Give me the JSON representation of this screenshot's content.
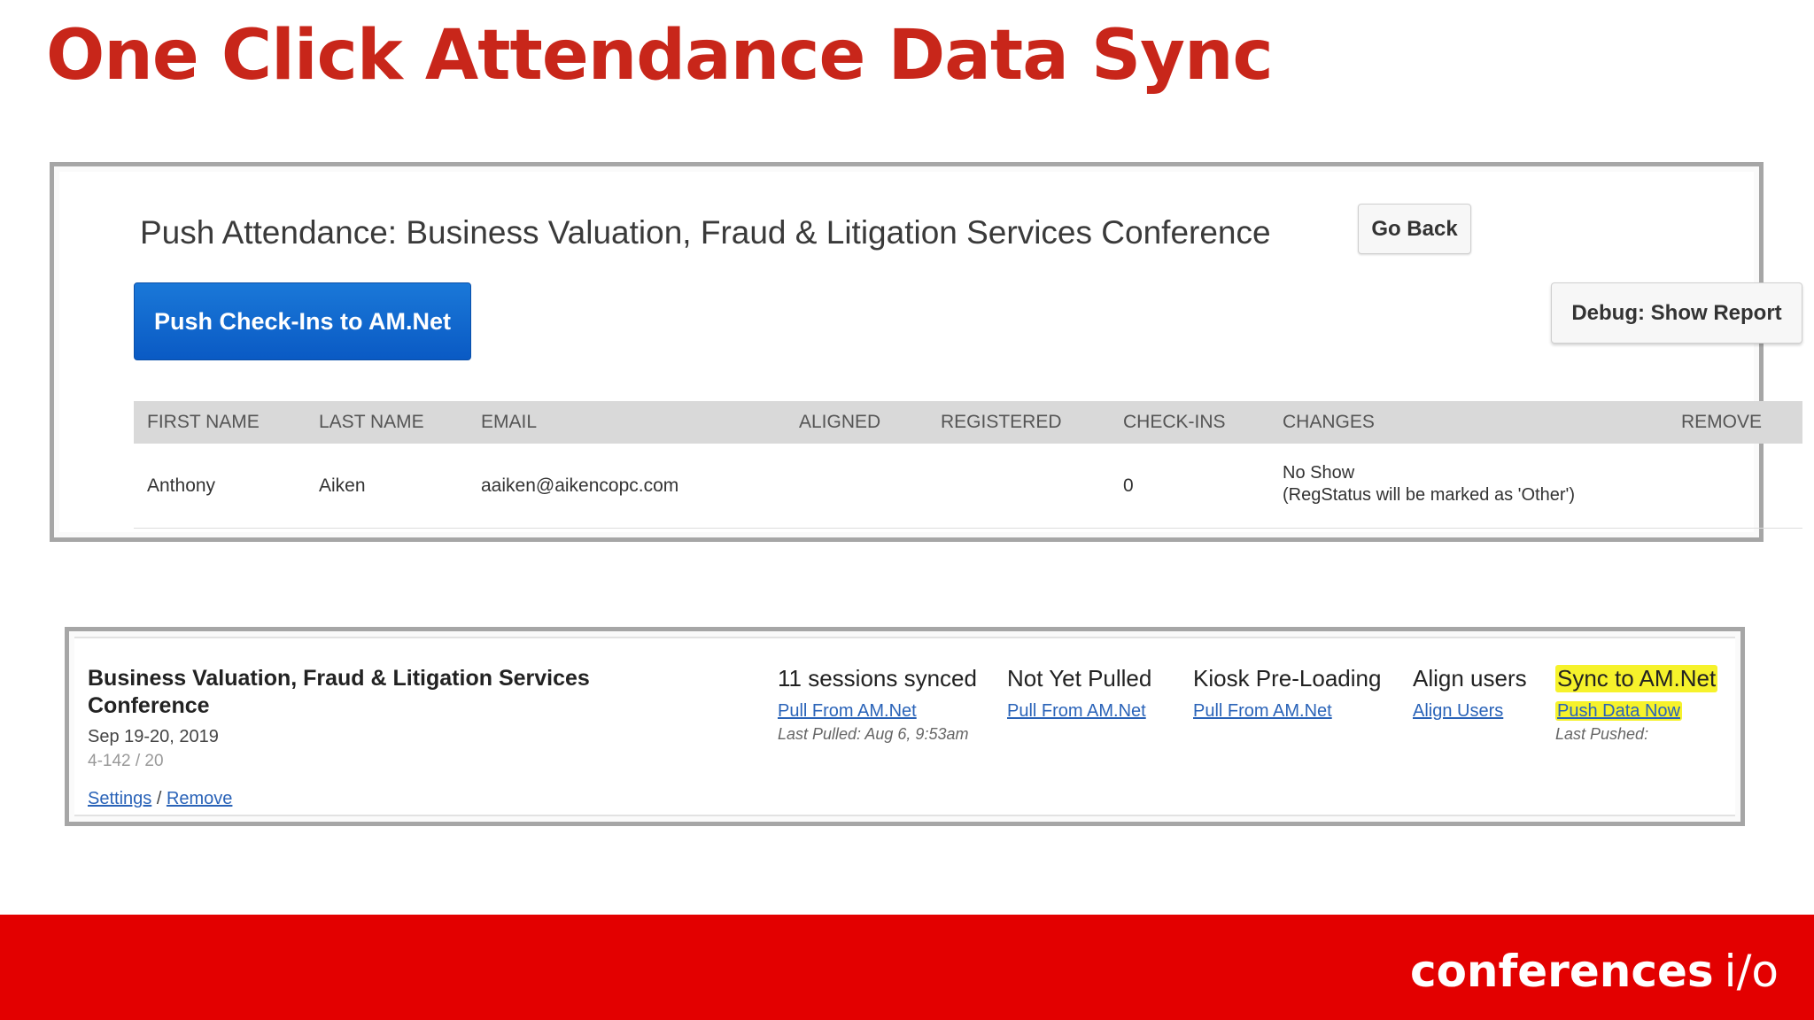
{
  "slide": {
    "title": "One Click Attendance Data Sync",
    "brand_name": "conferences",
    "brand_suffix": "i/o"
  },
  "push_panel": {
    "title": "Push Attendance: Business Valuation, Fraud & Litigation Services Conference",
    "go_back_label": "Go Back",
    "push_button_label": "Push Check-Ins to AM.Net",
    "debug_button_label": "Debug: Show Report",
    "columns": [
      "FIRST NAME",
      "LAST NAME",
      "EMAIL",
      "ALIGNED",
      "REGISTERED",
      "CHECK-INS",
      "CHANGES",
      "REMOVE"
    ],
    "rows": [
      {
        "first_name": "Anthony",
        "last_name": "Aiken",
        "email": "aaiken@aikencopc.com",
        "aligned": "",
        "registered": "",
        "check_ins": "0",
        "changes_line1": "No Show",
        "changes_line2": "(RegStatus will be marked as 'Other')",
        "remove": ""
      }
    ]
  },
  "conference_panel": {
    "name": "Business Valuation, Fraud & Litigation Services Conference",
    "dates": "Sep 19-20, 2019",
    "code": "4-142 / 20",
    "settings_link": "Settings",
    "separator": " / ",
    "remove_link": "Remove",
    "columns": [
      {
        "heading": "11 sessions synced",
        "link": "Pull From AM.Net",
        "sub": "Last Pulled: Aug 6, 9:53am"
      },
      {
        "heading": "Not Yet Pulled",
        "link": "Pull From AM.Net",
        "sub": ""
      },
      {
        "heading": "Kiosk Pre-Loading",
        "link": "Pull From AM.Net",
        "sub": ""
      },
      {
        "heading": "Align users",
        "link": "Align Users",
        "sub": ""
      },
      {
        "heading": "Sync to AM.Net",
        "link": "Push Data Now",
        "sub": "Last Pushed:"
      }
    ]
  },
  "colors": {
    "title_red": "#c8261a",
    "footer_red": "#e30000",
    "primary_blue": "#0a5ac4",
    "highlight_yellow": "#f6f22b",
    "link_blue": "#2a63b8"
  }
}
